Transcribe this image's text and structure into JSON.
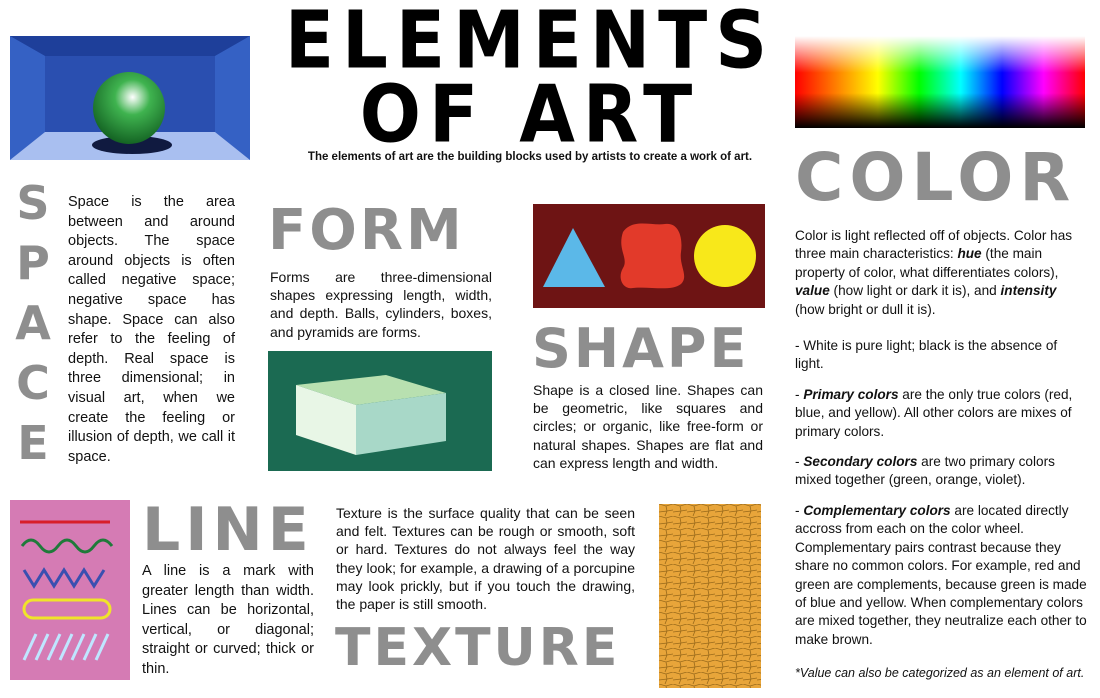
{
  "header": {
    "title_line1": "ELEMENTS",
    "title_line2": "OF ART",
    "subtitle": "The elements of art are the building blocks used by artists to create a work of art."
  },
  "space": {
    "letters": [
      "S",
      "P",
      "A",
      "C",
      "E"
    ],
    "text": "Space is the area between and around objects. The space around objects is often called negative space; negative space has shape. Space can also refer to the feeling of depth. Real space is three dimensional; in visual art, when we create the feeling or illusion of depth, we call it space."
  },
  "form": {
    "heading": "FORM",
    "text": "Forms are three-dimensional shapes expressing length, width, and depth. Balls, cylinders, boxes, and pyramids are forms."
  },
  "shape": {
    "heading": "SHAPE",
    "text": "Shape is a closed line. Shapes can be geometric, like squares and circles; or organic, like free-form or natural shapes. Shapes are flat and can express length and width."
  },
  "color": {
    "heading": "COLOR",
    "intro_1": "Color is light reflected off of objects. Color has three main characteristics: ",
    "hue_term": "hue",
    "intro_2": " (the main property of color, what differentiates colors), ",
    "value_term": "value",
    "intro_3": " (how light or dark it is), and ",
    "intensity_term": "intensity",
    "intro_4": " (how bright or dull it is).",
    "white_note": "- White is pure light; black is the absence of light.",
    "primary_prefix": "- ",
    "primary_term": "Primary colors",
    "primary_rest": " are the only true colors (red, blue, and yellow). All other colors are mixes of primary colors.",
    "secondary_prefix": "- ",
    "secondary_term": "Secondary colors",
    "secondary_rest": " are two primary colors mixed together (green, orange, violet).",
    "complementary_prefix": "- ",
    "complementary_term": "Complementary colors",
    "complementary_rest": " are located directly accross from each on the color wheel. Complementary pairs contrast because they share no common colors. For example, red and green are complements, because green is made of blue and yellow. When complementary colors are mixed together, they neutralize each other to make brown.",
    "footnote": "*Value can also be categorized as an element of art."
  },
  "line": {
    "heading": "LINE",
    "text": "A line is a mark with greater length than width. Lines can be horizontal, vertical, or diagonal; straight or curved; thick or thin."
  },
  "texture": {
    "heading": "TEXTURE",
    "text": "Texture is the surface quality that can be seen and felt. Textures can be rough or smooth, soft or hard. Textures do not always feel the way they look; for example, a drawing of a porcupine may look prickly, but if you touch the drawing, the paper is still smooth."
  },
  "colors": {
    "heading_gray": "#8e8e8e",
    "shape_bg": "#6e1414",
    "form_bg": "#1b6a52",
    "line_bg": "#d57bb4",
    "texture_fill": "#e8a53a"
  }
}
